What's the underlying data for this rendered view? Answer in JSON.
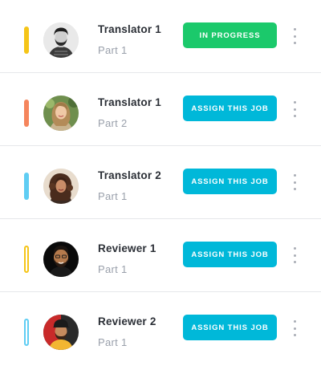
{
  "colors": {
    "yellow": "#f5c518",
    "orange": "#f5855c",
    "blue": "#5fcdf3",
    "green_button": "#1bc96b",
    "cyan_button": "#00b8d9"
  },
  "rows": [
    {
      "name": "Translator 1",
      "part": "Part 1",
      "action": "IN PROGRESS",
      "indicator_style": "solid",
      "indicator_color": "#f5c518",
      "avatar": "avatar-man-beard"
    },
    {
      "name": "Translator 1",
      "part": "Part 2",
      "action": "ASSIGN THIS JOB",
      "indicator_style": "solid",
      "indicator_color": "#f5855c",
      "avatar": "avatar-woman-blonde"
    },
    {
      "name": "Translator 2",
      "part": "Part 1",
      "action": "ASSIGN THIS JOB",
      "indicator_style": "solid",
      "indicator_color": "#5fcdf3",
      "avatar": "avatar-woman-curly"
    },
    {
      "name": "Reviewer 1",
      "part": "Part 1",
      "action": "ASSIGN THIS JOB",
      "indicator_style": "outline",
      "indicator_color": "#f5c518",
      "avatar": "avatar-man-dark"
    },
    {
      "name": "Reviewer 2",
      "part": "Part 1",
      "action": "ASSIGN THIS JOB",
      "indicator_style": "outline",
      "indicator_color": "#5fcdf3",
      "avatar": "avatar-man-cap"
    }
  ]
}
